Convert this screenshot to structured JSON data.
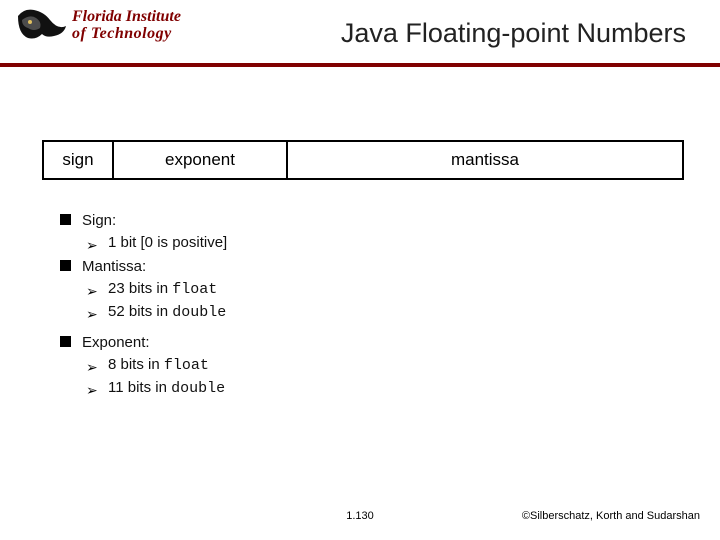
{
  "header": {
    "wordmark_line1": "Florida Institute",
    "wordmark_line2": "of Technology",
    "title": "Java Floating-point Numbers"
  },
  "diagram": {
    "sign": "sign",
    "exponent": "exponent",
    "mantissa": "mantissa"
  },
  "bullets": {
    "sign": {
      "label": "Sign:",
      "sub1_pre": "1 bit  [0 is positive]"
    },
    "mantissa": {
      "label": "Mantissa:",
      "sub1_pre": "23 bits in ",
      "sub1_kw": "float",
      "sub2_pre": "52 bits in ",
      "sub2_kw": "double"
    },
    "exponent": {
      "label": "Exponent:",
      "sub1_pre": "8 bits in ",
      "sub1_kw": "float",
      "sub2_pre": "11 bits in ",
      "sub2_kw": "double"
    }
  },
  "footer": {
    "page": "1.130",
    "copyright": "©Silberschatz, Korth and Sudarshan"
  }
}
